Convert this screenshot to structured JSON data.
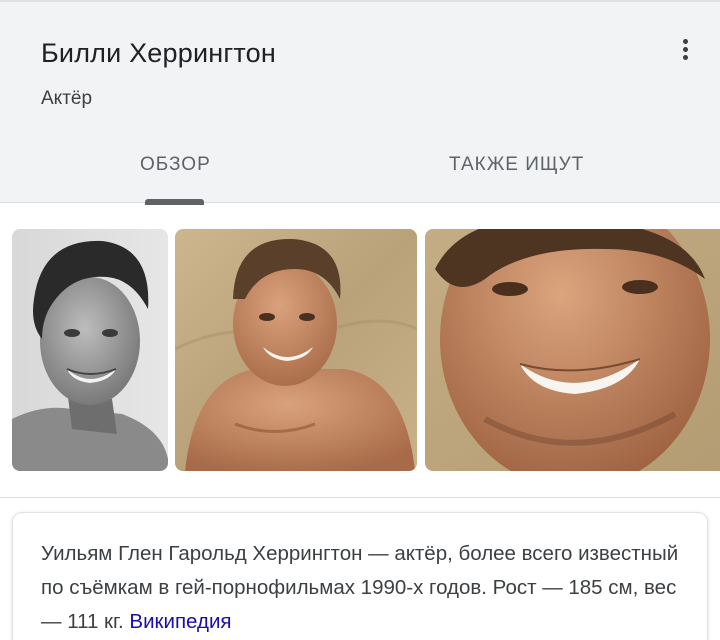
{
  "header": {
    "title": "Билли Херрингтон",
    "subtitle": "Актёр",
    "more_icon": "more-vert-icon"
  },
  "tabs": [
    {
      "label": "ОБЗОР",
      "active": true
    },
    {
      "label": "ТАКЖЕ ИЩУТ",
      "active": false
    }
  ],
  "images": [
    {
      "kind": "black-and-white portrait photo"
    },
    {
      "kind": "color photo on sand"
    },
    {
      "kind": "color close-up photo"
    }
  ],
  "description": {
    "text": "Уильям Глен Гарольд Херрингтон — актёр, более всего известный по съёмкам в гей-порнофильмах 1990-х годов. Рост — 185 см, вес — 111 кг.",
    "source_link": "Википедия",
    "link_color": "#1a0dab"
  },
  "colors": {
    "header_bg": "#f1f3f4",
    "tab_text": "#5f6368",
    "title_text": "#202124"
  }
}
